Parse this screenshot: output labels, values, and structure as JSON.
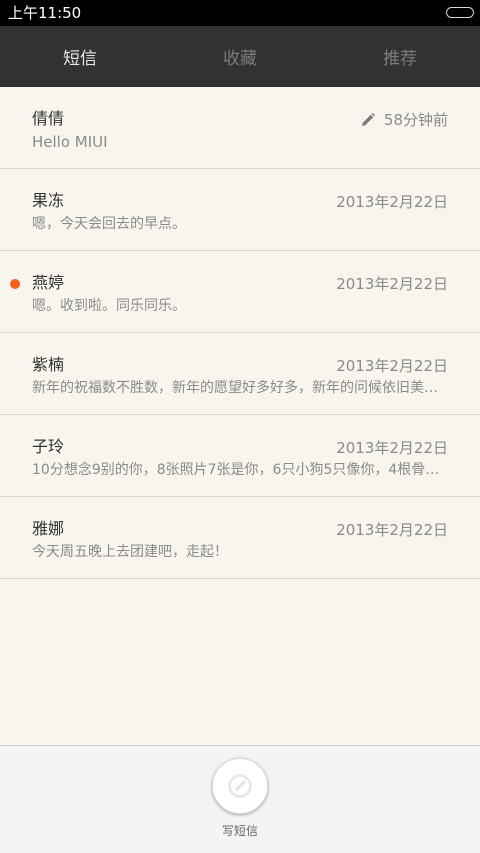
{
  "status_bar": {
    "time": "上午11:50",
    "battery_icon": "battery-icon"
  },
  "tabs": [
    {
      "label": "短信",
      "active": true
    },
    {
      "label": "收藏",
      "active": false
    },
    {
      "label": "推荐",
      "active": false
    }
  ],
  "conversations": [
    {
      "name": "倩倩",
      "time": "58分钟前",
      "preview": "Hello MIUI",
      "draft": true,
      "unread": false
    },
    {
      "name": "果冻",
      "time": "2013年2月22日",
      "preview": "嗯，今天会回去的早点。",
      "draft": false,
      "unread": false
    },
    {
      "name": "燕婷",
      "time": "2013年2月22日",
      "preview": "嗯。收到啦。同乐同乐。",
      "draft": false,
      "unread": true
    },
    {
      "name": "紫楠",
      "time": "2013年2月22日",
      "preview": "新年的祝福数不胜数，新年的愿望好多好多，新年的问候依旧美好...",
      "draft": false,
      "unread": false
    },
    {
      "name": "子玲",
      "time": "2013年2月22日",
      "preview": "10分想念9别的你，8张照片7张是你，6只小狗5只像你，4根骨头...",
      "draft": false,
      "unread": false
    },
    {
      "name": "雅娜",
      "time": "2013年2月22日",
      "preview": "今天周五晚上去团建吧，走起！",
      "draft": false,
      "unread": false
    }
  ],
  "colors": {
    "accent_unread": "#f25f1e",
    "tab_bar": "#323232",
    "list_bg": "#f8f5ee"
  },
  "compose": {
    "label": "写短信",
    "icon": "compose-icon"
  }
}
